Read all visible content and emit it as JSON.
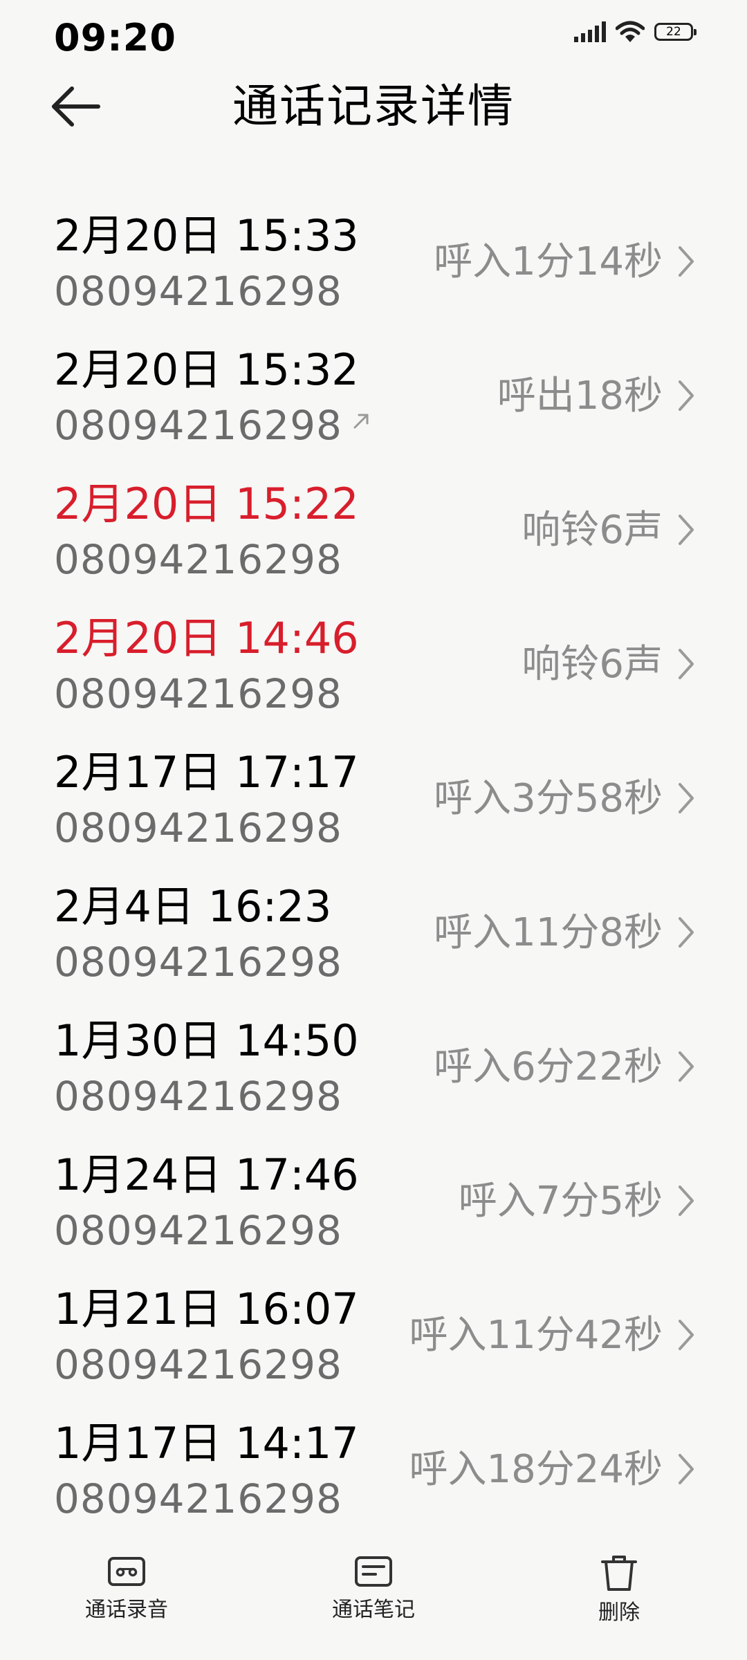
{
  "status_bar": {
    "time": "09:20",
    "battery": "22"
  },
  "header": {
    "title": "通话记录详情"
  },
  "calls": [
    {
      "time": "2月20日 15:33",
      "number": "08094216298",
      "result": "呼入1分14秒",
      "missed": false,
      "outgoing": false
    },
    {
      "time": "2月20日 15:32",
      "number": "08094216298",
      "result": "呼出18秒",
      "missed": false,
      "outgoing": true
    },
    {
      "time": "2月20日 15:22",
      "number": "08094216298",
      "result": "响铃6声",
      "missed": true,
      "outgoing": false
    },
    {
      "time": "2月20日 14:46",
      "number": "08094216298",
      "result": "响铃6声",
      "missed": true,
      "outgoing": false
    },
    {
      "time": "2月17日 17:17",
      "number": "08094216298",
      "result": "呼入3分58秒",
      "missed": false,
      "outgoing": false
    },
    {
      "time": "2月4日 16:23",
      "number": "08094216298",
      "result": "呼入11分8秒",
      "missed": false,
      "outgoing": false
    },
    {
      "time": "1月30日 14:50",
      "number": "08094216298",
      "result": "呼入6分22秒",
      "missed": false,
      "outgoing": false
    },
    {
      "time": "1月24日 17:46",
      "number": "08094216298",
      "result": "呼入7分5秒",
      "missed": false,
      "outgoing": false
    },
    {
      "time": "1月21日 16:07",
      "number": "08094216298",
      "result": "呼入11分42秒",
      "missed": false,
      "outgoing": false
    },
    {
      "time": "1月17日 14:17",
      "number": "08094216298",
      "result": "呼入18分24秒",
      "missed": false,
      "outgoing": false
    }
  ],
  "bottom_bar": {
    "recording_label": "通话录音",
    "notes_label": "通话笔记",
    "delete_label": "删除"
  },
  "colors": {
    "missed": "#d81e2c",
    "secondary_text": "#6b6b6b",
    "result_text": "#8c8c8c",
    "background": "#f7f7f5"
  }
}
